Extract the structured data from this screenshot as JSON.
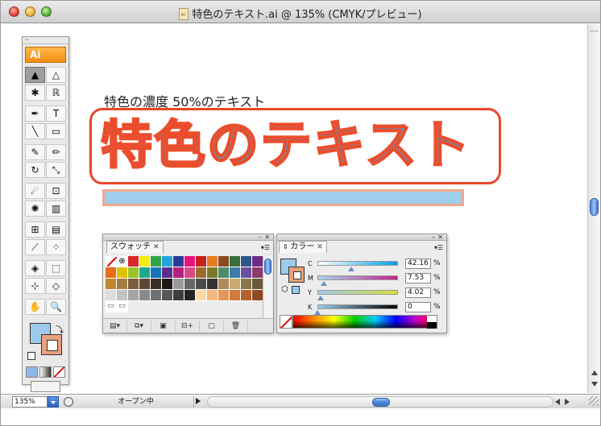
{
  "window": {
    "title": "特色のテキスト.ai @ 135% (CMYK/プレビュー)"
  },
  "tools": {
    "logo": "Ai",
    "items": [
      {
        "name": "selection-tool",
        "glyph": "▲",
        "selected": true
      },
      {
        "name": "direct-selection-tool",
        "glyph": "△"
      },
      {
        "name": "magic-wand-tool",
        "glyph": "✱"
      },
      {
        "name": "lasso-tool",
        "glyph": "ℝ"
      },
      {
        "name": "pen-tool",
        "glyph": "✒"
      },
      {
        "name": "type-tool",
        "glyph": "T"
      },
      {
        "name": "line-tool",
        "glyph": "╲"
      },
      {
        "name": "rectangle-tool",
        "glyph": "▭"
      },
      {
        "name": "paintbrush-tool",
        "glyph": "✎"
      },
      {
        "name": "pencil-tool",
        "glyph": "✏"
      },
      {
        "name": "rotate-tool",
        "glyph": "↻"
      },
      {
        "name": "scale-tool",
        "glyph": "⤡"
      },
      {
        "name": "warp-tool",
        "glyph": "☄"
      },
      {
        "name": "free-transform-tool",
        "glyph": "⊡"
      },
      {
        "name": "symbol-sprayer-tool",
        "glyph": "✺"
      },
      {
        "name": "graph-tool",
        "glyph": "▥"
      },
      {
        "name": "mesh-tool",
        "glyph": "⊞"
      },
      {
        "name": "gradient-tool",
        "glyph": "▤"
      },
      {
        "name": "eyedropper-tool",
        "glyph": "⟋"
      },
      {
        "name": "blend-tool",
        "glyph": "⁘"
      },
      {
        "name": "live-paint-bucket-tool",
        "glyph": "◈"
      },
      {
        "name": "live-paint-selection-tool",
        "glyph": "⬚"
      },
      {
        "name": "slice-tool",
        "glyph": "⊹"
      },
      {
        "name": "eraser-tool",
        "glyph": "◇"
      },
      {
        "name": "hand-tool",
        "glyph": "✋"
      },
      {
        "name": "zoom-tool",
        "glyph": "🔍"
      }
    ]
  },
  "artboard": {
    "caption": "特色の濃度 50%のテキスト",
    "headline": "特色のテキスト"
  },
  "swatches_panel": {
    "tab": "スウォッチ",
    "colors": [
      "#ffffff",
      "#000000",
      "#d9262b",
      "#f6eb14",
      "#35a449",
      "#25a4da",
      "#2a3c97",
      "#e4157f",
      "#c8201f",
      "#e57c1f",
      "#8a4b24",
      "#3a6e39",
      "#2e5689",
      "#6f2d89",
      "#e66c1b",
      "#e0c300",
      "#9bc22a",
      "#1fa88e",
      "#1873b8",
      "#5a2d8d",
      "#b1207a",
      "#d64b86",
      "#9b6b2e",
      "#7a7a28",
      "#4a8c6a",
      "#3d7aa8",
      "#6b4e9e",
      "#8c3b6a",
      "#c2862f",
      "#a27c45",
      "#7f5d3c",
      "#5c4532",
      "#3a2e25",
      "#1f1915",
      "#9a9a9a",
      "#666666",
      "#4a4a4a",
      "#333333",
      "#ad8d5a",
      "#c9a872",
      "#8a7449",
      "#6b5a38",
      "#dddddd",
      "#c2c2c2",
      "#a5a5a5",
      "#8a8a8a",
      "#707070",
      "#565656",
      "#3d3d3d",
      "#252525",
      "#ffd9a8",
      "#f2b880",
      "#e5975c",
      "#d07a3e",
      "#b5622c",
      "#8f4a1f"
    ],
    "toolbar": [
      "▤▾",
      "⧉▾",
      "▣",
      "⊟+",
      "▢",
      "🗑"
    ]
  },
  "color_panel": {
    "tab": "カラー",
    "channels": [
      {
        "label": "C",
        "value": "42.16",
        "level": 0.4216,
        "track": "linear-gradient(to right, #ffffff, #00a0e9)"
      },
      {
        "label": "M",
        "value": "7.53",
        "level": 0.0753,
        "track": "linear-gradient(to right, #a8d4ee, #c8228a)"
      },
      {
        "label": "Y",
        "value": "4.02",
        "level": 0.0402,
        "track": "linear-gradient(to right, #9ccbeb, #d6e13a)"
      },
      {
        "label": "K",
        "value": "0",
        "level": 0.0,
        "track": "linear-gradient(to right, #9ccbeb, #000000)"
      }
    ],
    "unit": "%"
  },
  "status": {
    "zoom": "135%",
    "text": "オープン中"
  },
  "colors": {
    "fill": "#9ccbeb",
    "stroke": "#e8a27c",
    "headline_fill": "#35a6e0",
    "headline_stroke": "#ec4d2c"
  }
}
